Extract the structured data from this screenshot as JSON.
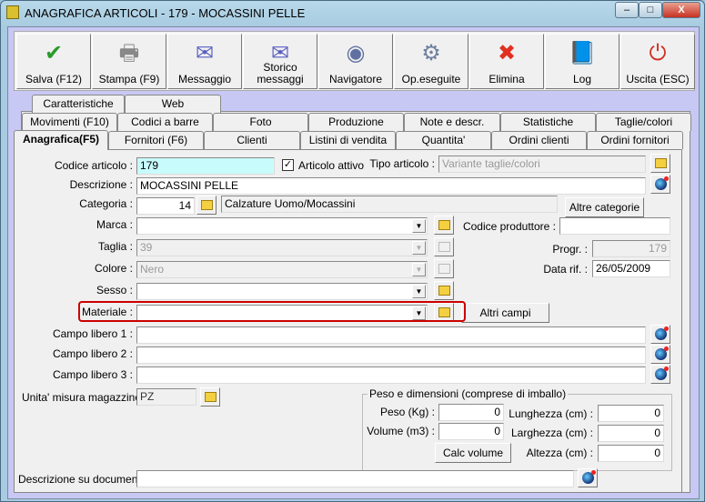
{
  "window": {
    "title": "ANAGRAFICA ARTICOLI - 179 - MOCASSINI PELLE",
    "minimize": "–",
    "maximize": "□",
    "close": "X"
  },
  "toolbar": [
    {
      "label": "Salva (F12)",
      "icon": "check-icon",
      "color": "#2a9a2a"
    },
    {
      "label": "Stampa (F9)",
      "icon": "printer-icon",
      "color": "#888888"
    },
    {
      "label": "Messaggio",
      "icon": "envelope-pen-icon",
      "color": "#5a60c0"
    },
    {
      "label": "Storico messaggi",
      "icon": "envelope-search-icon",
      "color": "#5a60c0"
    },
    {
      "label": "Navigatore",
      "icon": "compass-icon",
      "color": "#6070a0"
    },
    {
      "label": "Op.eseguite",
      "icon": "gears-search-icon",
      "color": "#7080a0"
    },
    {
      "label": "Elimina",
      "icon": "x-icon",
      "color": "#e03020"
    },
    {
      "label": "Log",
      "icon": "book-search-icon",
      "color": "#2060c0"
    },
    {
      "label": "Uscita (ESC)",
      "icon": "power-icon",
      "color": "#d03020"
    }
  ],
  "tabs": {
    "row1": [
      "Caratteristiche",
      "Web"
    ],
    "row2": [
      "Movimenti (F10)",
      "Codici a barre",
      "Foto",
      "Produzione",
      "Note e descr.",
      "Statistiche",
      "Taglie/colori"
    ],
    "row3": [
      "Anagrafica(F5)",
      "Fornitori (F6)",
      "Clienti",
      "Listini di vendita",
      "Quantita'",
      "Ordini clienti",
      "Ordini fornitori"
    ]
  },
  "form": {
    "codice_label": "Codice articolo :",
    "codice": "179",
    "attivo_label": "Articolo attivo",
    "attivo_check": "✓",
    "tipo_label": "Tipo articolo :",
    "tipo": "Variante taglie/colori",
    "descrizione_label": "Descrizione :",
    "descrizione": "MOCASSINI PELLE",
    "categoria_label": "Categoria :",
    "categoria_code": "14",
    "categoria_name": "Calzature Uomo/Mocassini",
    "altre_categorie": "Altre categorie",
    "marca_label": "Marca :",
    "marca": "",
    "codice_produttore_label": "Codice produttore :",
    "codice_produttore": "",
    "taglia_label": "Taglia :",
    "taglia": "39",
    "progr_label": "Progr. :",
    "progr": "179",
    "colore_label": "Colore :",
    "colore": "Nero",
    "data_label": "Data rif. :",
    "data": "26/05/2009",
    "sesso_label": "Sesso :",
    "sesso": "",
    "materiale_label": "Materiale :",
    "materiale": "",
    "altri_campi": "Altri campi",
    "campo1_label": "Campo libero 1 :",
    "campo2_label": "Campo libero 2 :",
    "campo3_label": "Campo libero 3 :",
    "um_label": "Unita' misura magazzino :",
    "um": "PZ",
    "group_title": "Peso e dimensioni (comprese di imballo)",
    "peso_label": "Peso (Kg) :",
    "peso": "0",
    "volume_label": "Volume (m3) :",
    "volume": "0",
    "lunghezza_label": "Lunghezza (cm) :",
    "lunghezza": "0",
    "larghezza_label": "Larghezza (cm) :",
    "larghezza": "0",
    "altezza_label": "Altezza (cm) :",
    "altezza": "0",
    "calc_volume": "Calc volume",
    "desc_doc_label": "Descrizione su documenti :",
    "desc_doc": ""
  }
}
